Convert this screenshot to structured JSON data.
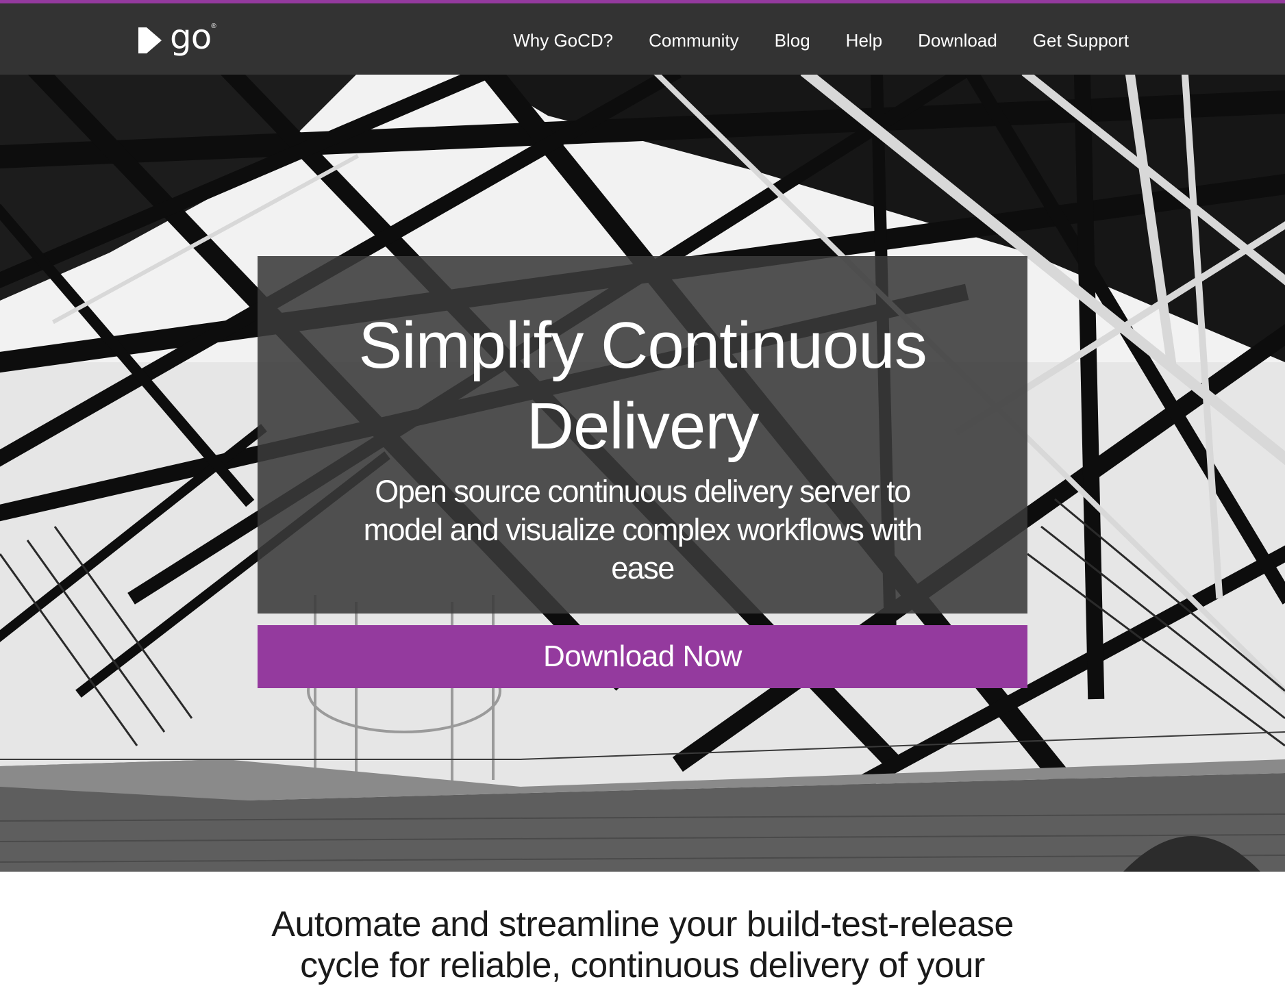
{
  "brand": {
    "logo_text": "go",
    "logo_reg_mark": "®",
    "accent_color": "#943a9e",
    "nav_bg_color": "#333333"
  },
  "nav": {
    "items": [
      {
        "label": "Why GoCD?"
      },
      {
        "label": "Community"
      },
      {
        "label": "Blog"
      },
      {
        "label": "Help"
      },
      {
        "label": "Download"
      },
      {
        "label": "Get Support"
      }
    ]
  },
  "hero": {
    "title": "Simplify Continuous Delivery",
    "subtitle": "Open source continuous delivery server to model and visualize complex workflows with ease",
    "cta_label": "Download Now",
    "background": "black-and-white photo of steel bridge truss over brick fort"
  },
  "intro": {
    "text": "Automate and streamline your build-test-release cycle for reliable, continuous delivery of your"
  }
}
